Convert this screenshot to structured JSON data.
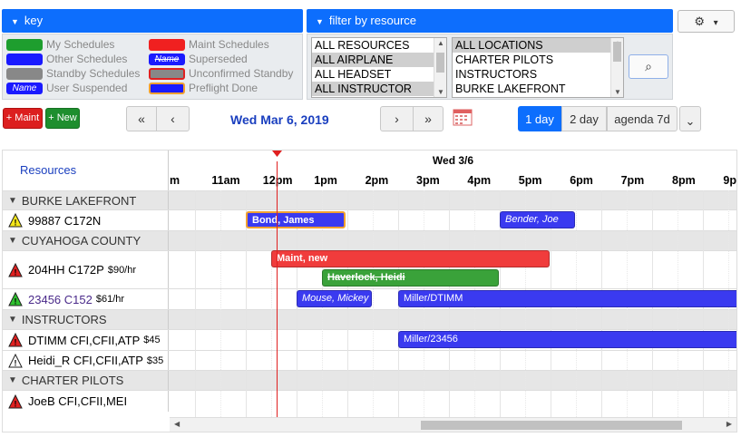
{
  "key": {
    "header": "key",
    "items": [
      {
        "label": "My Schedules",
        "color": "#1e9e2e",
        "swatch_text": ""
      },
      {
        "label": "Maint Schedules",
        "color": "#f02020",
        "swatch_text": ""
      },
      {
        "label": "Other Schedules",
        "color": "#1a1aff",
        "swatch_text": ""
      },
      {
        "label": "Superseded",
        "color": "#1a1aff",
        "swatch_text": "Name"
      },
      {
        "label": "Standby Schedules",
        "color": "#888888",
        "swatch_text": ""
      },
      {
        "label": "Unconfirmed Standby",
        "color": "#888888",
        "swatch_text": ""
      },
      {
        "label": "User Suspended",
        "color": "#1a1aff",
        "swatch_text": "Name"
      },
      {
        "label": "Preflight Done",
        "color": "#1a1aff",
        "swatch_text": ""
      }
    ]
  },
  "filter": {
    "header": "filter by resource",
    "resources": [
      "ALL RESOURCES",
      "ALL AIRPLANE",
      "ALL HEADSET",
      "ALL INSTRUCTOR"
    ],
    "locations": [
      "ALL LOCATIONS",
      "CHARTER PILOTS",
      "INSTRUCTORS",
      "BURKE LAKEFRONT"
    ],
    "search_icon": "⌕"
  },
  "settings": {
    "icon": "⚙",
    "caret": "▾"
  },
  "toolbar": {
    "maint_label": "+ Maint",
    "new_label": "+ New",
    "first_label": "«",
    "prev_label": "‹",
    "next_label": "›",
    "last_label": "»",
    "date_label": "Wed Mar 6, 2019",
    "views": [
      "1 day",
      "2 day",
      "agenda 7d"
    ],
    "more_caret": "⌄"
  },
  "calendar": {
    "resources_header": "Resources",
    "day_label": "Wed 3/6",
    "hours": [
      "m",
      "11am",
      "12pm",
      "1pm",
      "2pm",
      "3pm",
      "4pm",
      "5pm",
      "6pm",
      "7pm",
      "8pm",
      "9pm"
    ],
    "rows": [
      {
        "type": "group",
        "label": "BURKE LAKEFRONT"
      },
      {
        "type": "res",
        "label": "99887 C172N",
        "rate": "",
        "icon": "yellow"
      },
      {
        "type": "group",
        "label": "CUYAHOGA COUNTY"
      },
      {
        "type": "res",
        "label": "204HH C172P",
        "rate": "$90/hr",
        "icon": "red"
      },
      {
        "type": "res",
        "label": "23456 C152",
        "rate": "$61/hr",
        "icon": "green"
      },
      {
        "type": "group",
        "label": "INSTRUCTORS"
      },
      {
        "type": "res",
        "label": "DTIMM CFI,CFII,ATP",
        "rate": "$45",
        "icon": "red"
      },
      {
        "type": "res",
        "label": "Heidi_R CFI,CFII,ATP",
        "rate": "$35",
        "icon": "white"
      },
      {
        "type": "group",
        "label": "CHARTER PILOTS"
      },
      {
        "type": "res",
        "label": "JoeB CFI,CFII,MEI",
        "rate": "",
        "icon": "red"
      }
    ],
    "events": [
      {
        "label": "Bond, James",
        "color": "#3a3af0"
      },
      {
        "label": "Bender, Joe",
        "color": "#3a3af0"
      },
      {
        "label": "Maint, new",
        "color": "#f03c3c"
      },
      {
        "label": "Haverlock, Heidi",
        "color": "#3aa23a"
      },
      {
        "label": "Mouse, Mickey",
        "color": "#3a3af0"
      },
      {
        "label": "Miller/DTIMM",
        "color": "#3a3af0"
      },
      {
        "label": "Miller/23456",
        "color": "#3a3af0"
      }
    ]
  }
}
